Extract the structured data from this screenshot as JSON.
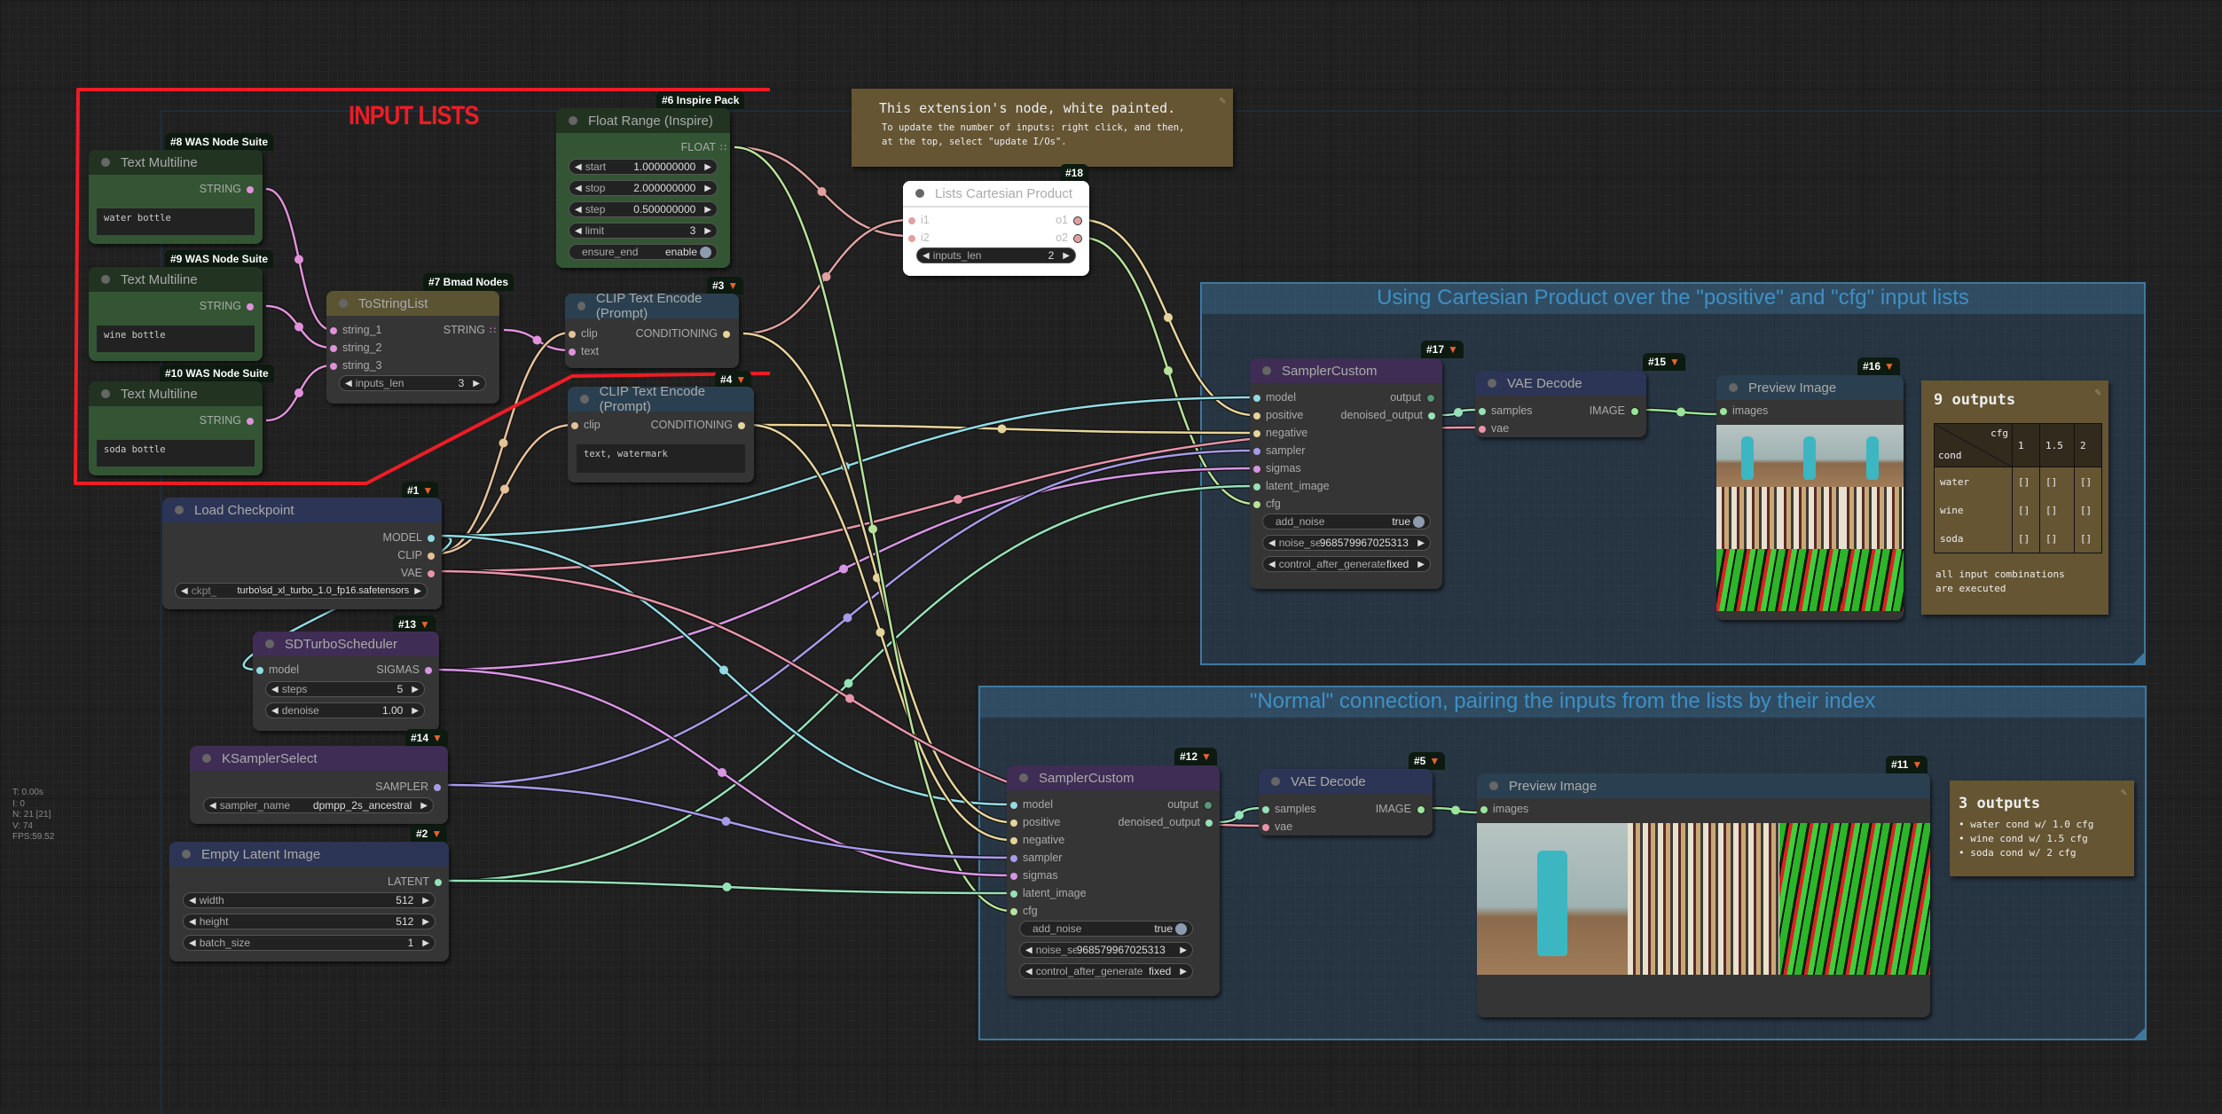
{
  "annotation": {
    "title": "INPUT LISTS",
    "color": "#ee1c25"
  },
  "stats": [
    "T: 0.00s",
    "I: 0",
    "N: 21 [21]",
    "V: 74",
    "FPS:59.52"
  ],
  "groups": {
    "cartesian": {
      "title": "Using Cartesian Product over the \"positive\" and \"cfg\" input lists"
    },
    "normal": {
      "title": "\"Normal\" connection, pairing the inputs from the lists by their index"
    }
  },
  "notes": {
    "white_painted": {
      "title": "This extension's node, white painted.",
      "body_line1": "To update the number of inputs: right click, and then,",
      "body_line2": "at the top, select \"update I/Os\"."
    },
    "nine_outputs": {
      "title": "9 outputs",
      "table": {
        "corner_top": "cfg",
        "corner_bottom": "cond",
        "columns": [
          "1",
          "1.5",
          "2"
        ],
        "rows": [
          {
            "label": "water",
            "cells": [
              "[]",
              "[]",
              "[]"
            ]
          },
          {
            "label": "wine",
            "cells": [
              "[]",
              "[]",
              "[]"
            ]
          },
          {
            "label": "soda",
            "cells": [
              "[]",
              "[]",
              "[]"
            ]
          }
        ]
      },
      "footer_line1": "all input combinations",
      "footer_line2": "are executed"
    },
    "three_outputs": {
      "title": "3 outputs",
      "items": [
        "water cond w/ 1.0 cfg",
        "wine cond w/ 1.5 cfg",
        "soda cond w/ 2 cfg"
      ]
    }
  },
  "nodes": {
    "n8": {
      "badge": "#8 WAS Node Suite",
      "title": "Text Multiline",
      "output": "STRING",
      "text": "water bottle"
    },
    "n9": {
      "badge": "#9 WAS Node Suite",
      "title": "Text Multiline",
      "output": "STRING",
      "text": "wine bottle"
    },
    "n10": {
      "badge": "#10 WAS Node Suite",
      "title": "Text Multiline",
      "output": "STRING",
      "text": "soda bottle"
    },
    "n7": {
      "badge": "#7 Bmad Nodes",
      "title": "ToStringList",
      "inputs": [
        "string_1",
        "string_2",
        "string_3"
      ],
      "output": "STRING",
      "widget_label": "inputs_len",
      "widget_value": "3"
    },
    "n6": {
      "badge": "#6 Inspire Pack",
      "title": "Float Range (Inspire)",
      "output": "FLOAT",
      "widgets": [
        {
          "label": "start",
          "value": "1.000000000"
        },
        {
          "label": "stop",
          "value": "2.000000000"
        },
        {
          "label": "step",
          "value": "0.500000000"
        },
        {
          "label": "limit",
          "value": "3"
        }
      ],
      "toggle": {
        "label": "ensure_end",
        "value": "enable"
      }
    },
    "n3": {
      "badge": "#3",
      "title": "CLIP Text Encode (Prompt)",
      "inputs": [
        "clip",
        "text"
      ],
      "output": "CONDITIONING"
    },
    "n4": {
      "badge": "#4",
      "title": "CLIP Text Encode (Prompt)",
      "inputs": [
        "clip"
      ],
      "output": "CONDITIONING",
      "text": "text, watermark"
    },
    "n18": {
      "badge": "#18",
      "title": "Lists Cartesian Product",
      "inputs": [
        "i1",
        "i2"
      ],
      "outputs": [
        "o1",
        "o2"
      ],
      "widget_label": "inputs_len",
      "widget_value": "2"
    },
    "n1": {
      "badge": "#1",
      "title": "Load Checkpoint",
      "outputs": [
        "MODEL",
        "CLIP",
        "VAE"
      ],
      "widget_label": "ckpt_name",
      "widget_value": "turbo\\sd_xl_turbo_1.0_fp16.safetensors"
    },
    "n13": {
      "badge": "#13",
      "title": "SDTurboScheduler",
      "inputs": [
        "model"
      ],
      "output": "SIGMAS",
      "widgets": [
        {
          "label": "steps",
          "value": "5"
        },
        {
          "label": "denoise",
          "value": "1.00"
        }
      ]
    },
    "n14": {
      "badge": "#14",
      "title": "KSamplerSelect",
      "output": "SAMPLER",
      "widget_label": "sampler_name",
      "widget_value": "dpmpp_2s_ancestral"
    },
    "n2": {
      "badge": "#2",
      "title": "Empty Latent Image",
      "output": "LATENT",
      "widgets": [
        {
          "label": "width",
          "value": "512"
        },
        {
          "label": "height",
          "value": "512"
        },
        {
          "label": "batch_size",
          "value": "1"
        }
      ]
    },
    "n17": {
      "badge": "#17",
      "title": "SamplerCustom",
      "inputs": [
        "model",
        "positive",
        "negative",
        "sampler",
        "sigmas",
        "latent_image",
        "cfg"
      ],
      "outputs": [
        "output",
        "denoised_output"
      ],
      "toggle": {
        "label": "add_noise",
        "value": "true"
      },
      "widgets": [
        {
          "label": "noise_seed",
          "value": "968579967025313"
        },
        {
          "label": "control_after_generate",
          "value": "fixed"
        }
      ]
    },
    "n15": {
      "badge": "#15",
      "title": "VAE Decode",
      "inputs": [
        "samples",
        "vae"
      ],
      "output": "IMAGE"
    },
    "n16": {
      "badge": "#16",
      "title": "Preview Image",
      "inputs": [
        "images"
      ]
    },
    "n12": {
      "badge": "#12",
      "title": "SamplerCustom",
      "inputs": [
        "model",
        "positive",
        "negative",
        "sampler",
        "sigmas",
        "latent_image",
        "cfg"
      ],
      "outputs": [
        "output",
        "denoised_output"
      ],
      "toggle": {
        "label": "add_noise",
        "value": "true"
      },
      "widgets": [
        {
          "label": "noise_seed",
          "value": "968579967025313"
        },
        {
          "label": "control_after_generate",
          "value": "fixed"
        }
      ]
    },
    "n5": {
      "badge": "#5",
      "title": "VAE Decode",
      "inputs": [
        "samples",
        "vae"
      ],
      "output": "IMAGE"
    },
    "n11": {
      "badge": "#11",
      "title": "Preview Image",
      "inputs": [
        "images"
      ]
    }
  },
  "colors": {
    "STRING": "#e091d9",
    "FLOAT": "#e0a0a0",
    "CONDITIONING": "#e6d49a",
    "CLIP": "#e5c19a",
    "MODEL": "#91dbe3",
    "VAE": "#e894a8",
    "SIGMAS": "#d895e4",
    "SAMPLER": "#a79ae8",
    "LATENT": "#96e1b8",
    "IMAGE": "#9ae59a",
    "CFG": "#b6e39a"
  },
  "icons": {
    "fox": "fox-icon",
    "edit": "edit-icon",
    "grid": "list-output-icon"
  }
}
